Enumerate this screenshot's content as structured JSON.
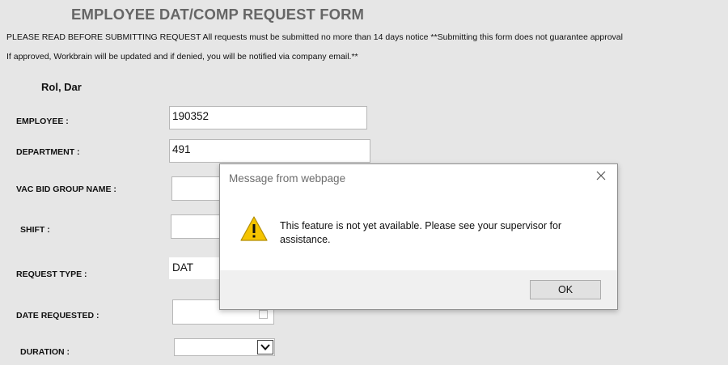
{
  "form": {
    "title": "EMPLOYEE DAT/COMP REQUEST FORM",
    "notice_line1": "PLEASE READ BEFORE SUBMITTING REQUEST All requests must be submitted no more than 14 days notice **Submitting this form does not guarantee approval",
    "notice_line2": "If approved, Workbrain will be updated and if denied, you will be notified via company email.**",
    "employee_name": "Rol, Dar",
    "fields": {
      "employee": {
        "label": "EMPLOYEE :",
        "value": "190352"
      },
      "department": {
        "label": "DEPARTMENT :",
        "value": "491"
      },
      "vac_bid_group": {
        "label": "VAC BID GROUP NAME :",
        "value": ""
      },
      "shift": {
        "label": "SHIFT :",
        "value": ""
      },
      "request_type": {
        "label": "REQUEST TYPE :",
        "value": "DAT"
      },
      "date_requested": {
        "label": "DATE REQUESTED :",
        "value": ""
      },
      "duration": {
        "label": "DURATION :",
        "value": ""
      }
    }
  },
  "dialog": {
    "title": "Message from webpage",
    "message": "This feature is not yet available. Please see your supervisor for assistance.",
    "ok_label": "OK",
    "icon": "warning-icon",
    "icon_color": "#f5c400"
  },
  "colors": {
    "page_bg": "#e6e6e6",
    "title_gray": "#666666",
    "dialog_footer": "#f0f0f0"
  }
}
